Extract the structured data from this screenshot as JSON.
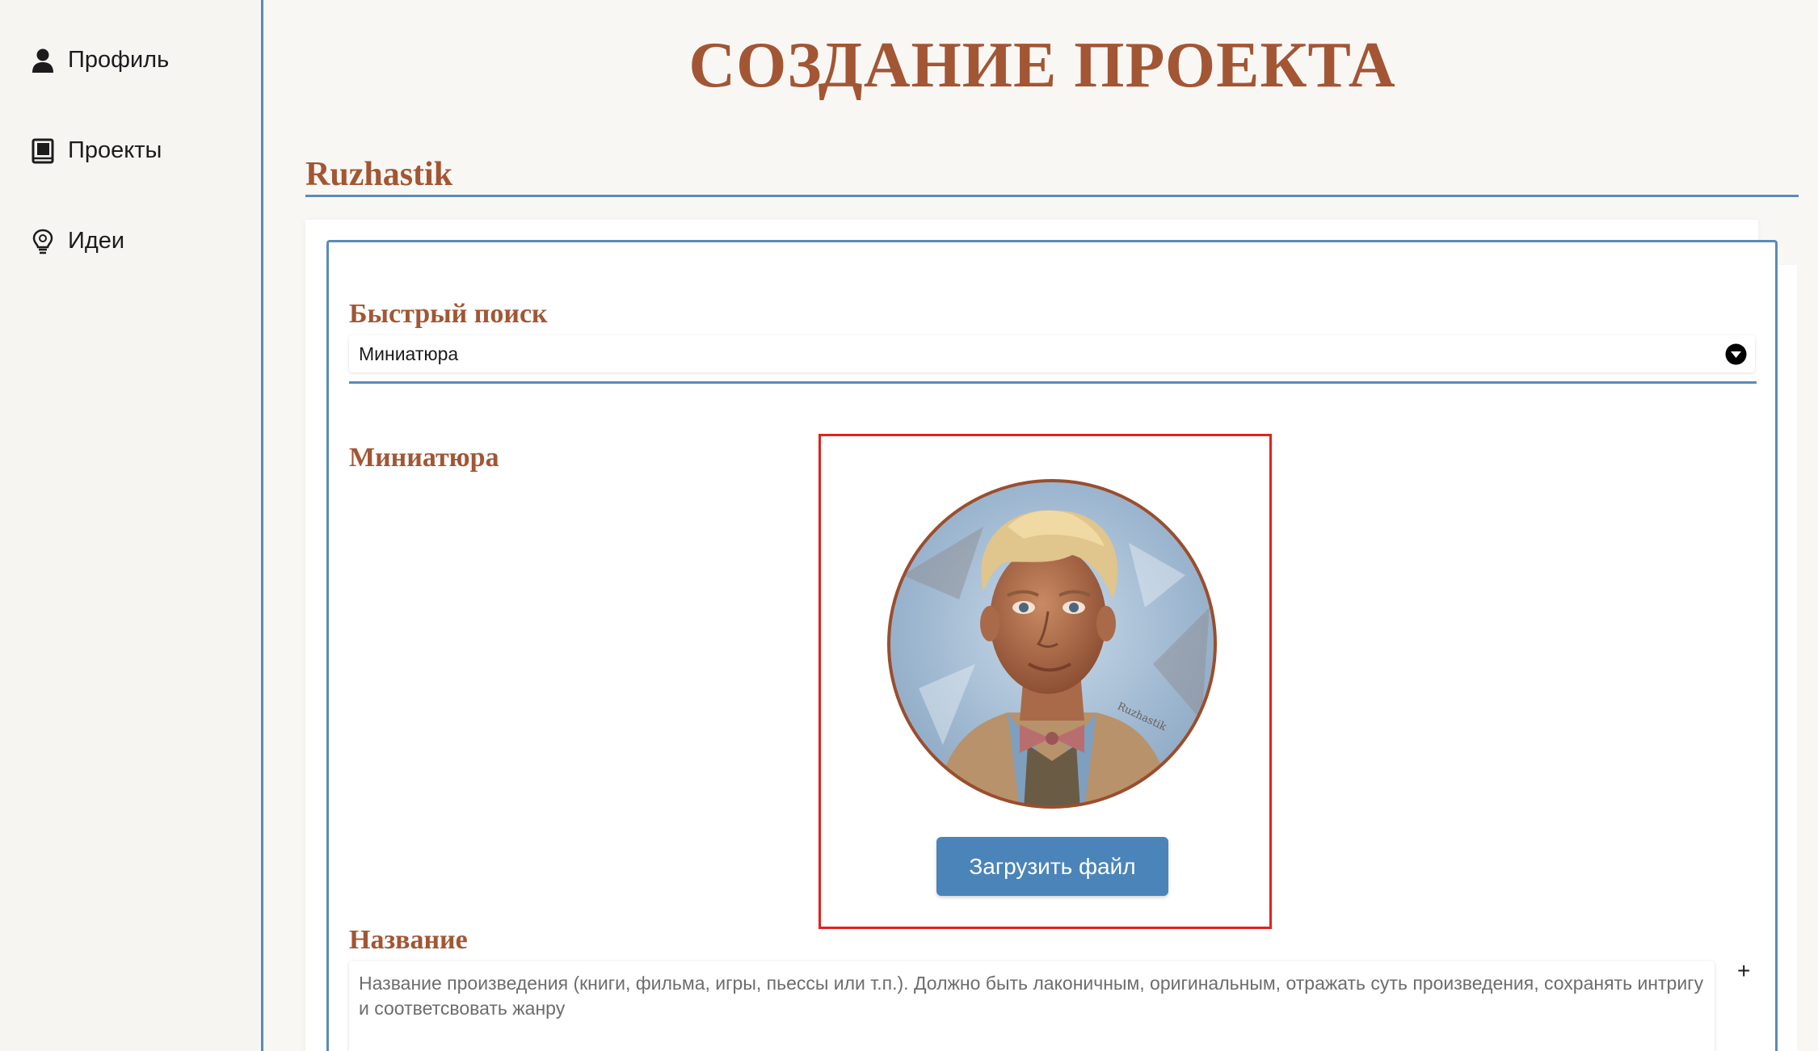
{
  "sidebar": {
    "items": [
      {
        "label": "Профиль",
        "icon": "user-icon"
      },
      {
        "label": "Проекты",
        "icon": "book-icon"
      },
      {
        "label": "Идеи",
        "icon": "lightbulb-icon"
      }
    ]
  },
  "header": {
    "title": "СОЗДАНИЕ ПРОЕКТА",
    "username": "Ruzhastik"
  },
  "form": {
    "quick_search": {
      "label": "Быстрый поиск",
      "selected": "Миниатюра"
    },
    "thumbnail": {
      "label": "Миниатюра",
      "upload_label": "Загрузить файл",
      "image_signature": "Ruzhastik"
    },
    "title_field": {
      "label": "Название",
      "placeholder": "Название произведения (книги, фильма, игры, пьессы или т.п.). Должно быть лаконичным, оригинальным, отражать суть произведения, сохранять интригу и соответсвовать жанру",
      "add_label": "+"
    }
  },
  "colors": {
    "accent_brown": "#a25634",
    "accent_blue": "#5b8bb8",
    "button_blue": "#4b84b8",
    "highlight_red": "#e0231c"
  }
}
